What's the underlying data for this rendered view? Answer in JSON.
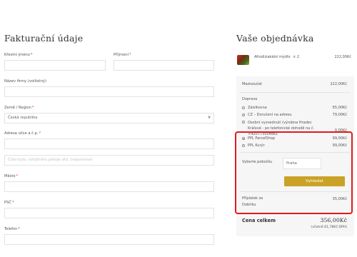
{
  "billing": {
    "title": "Fakturační údaje",
    "first_name_label": "Křestní jméno",
    "last_name_label": "Příjmení",
    "company_label": "Název firmy (volitelný)",
    "country_label": "Země / Region",
    "country_value": "Česká republika",
    "address_label": "Adresa ulice a č.p.",
    "address2_placeholder": "Číslo bytu, totožného pokoje atd. (nepovinné)",
    "city_label": "Město",
    "zip_label": "PSČ",
    "phone_label": "Telefon",
    "required_mark": "*"
  },
  "order": {
    "title": "Vaše objednávka",
    "product": {
      "name": "Afrodiziakální mýdlo",
      "qty": "× 2",
      "price": "222,00Kč"
    },
    "subtotal_label": "Mezisoučet",
    "subtotal_value": "222,00Kč",
    "shipping_label": "Doprava",
    "shipping_options": [
      {
        "label": "Zásilkovna",
        "price": "65,00Kč",
        "selected": false
      },
      {
        "label": "CZ – Doručení na adresu",
        "price": "79,00Kč",
        "selected": false
      },
      {
        "label": "Osobní vyzvednutí (výrobna Hradec Králové - po telefonické dohodě na č. +420773504861",
        "price": "0,00Kč",
        "selected": false
      },
      {
        "label": "PPL ParcelShop",
        "price": "99,00Kč",
        "selected": true
      },
      {
        "label": "PPL Kurýr",
        "price": "99,00Kč",
        "selected": false
      }
    ],
    "branch_label": "Vyberte pobočku",
    "branch_value": "Praha",
    "branch_button": "Vyhledat",
    "cod_label": "Příplatek za Dobírku",
    "cod_value": "35,00Kč",
    "total_label": "Cena celkem",
    "total_value": "356,00Kč",
    "vat_note": "(včetně 61,78Kč DPH)"
  },
  "colors": {
    "accent": "#c9a227",
    "highlight": "#e01b1b"
  }
}
